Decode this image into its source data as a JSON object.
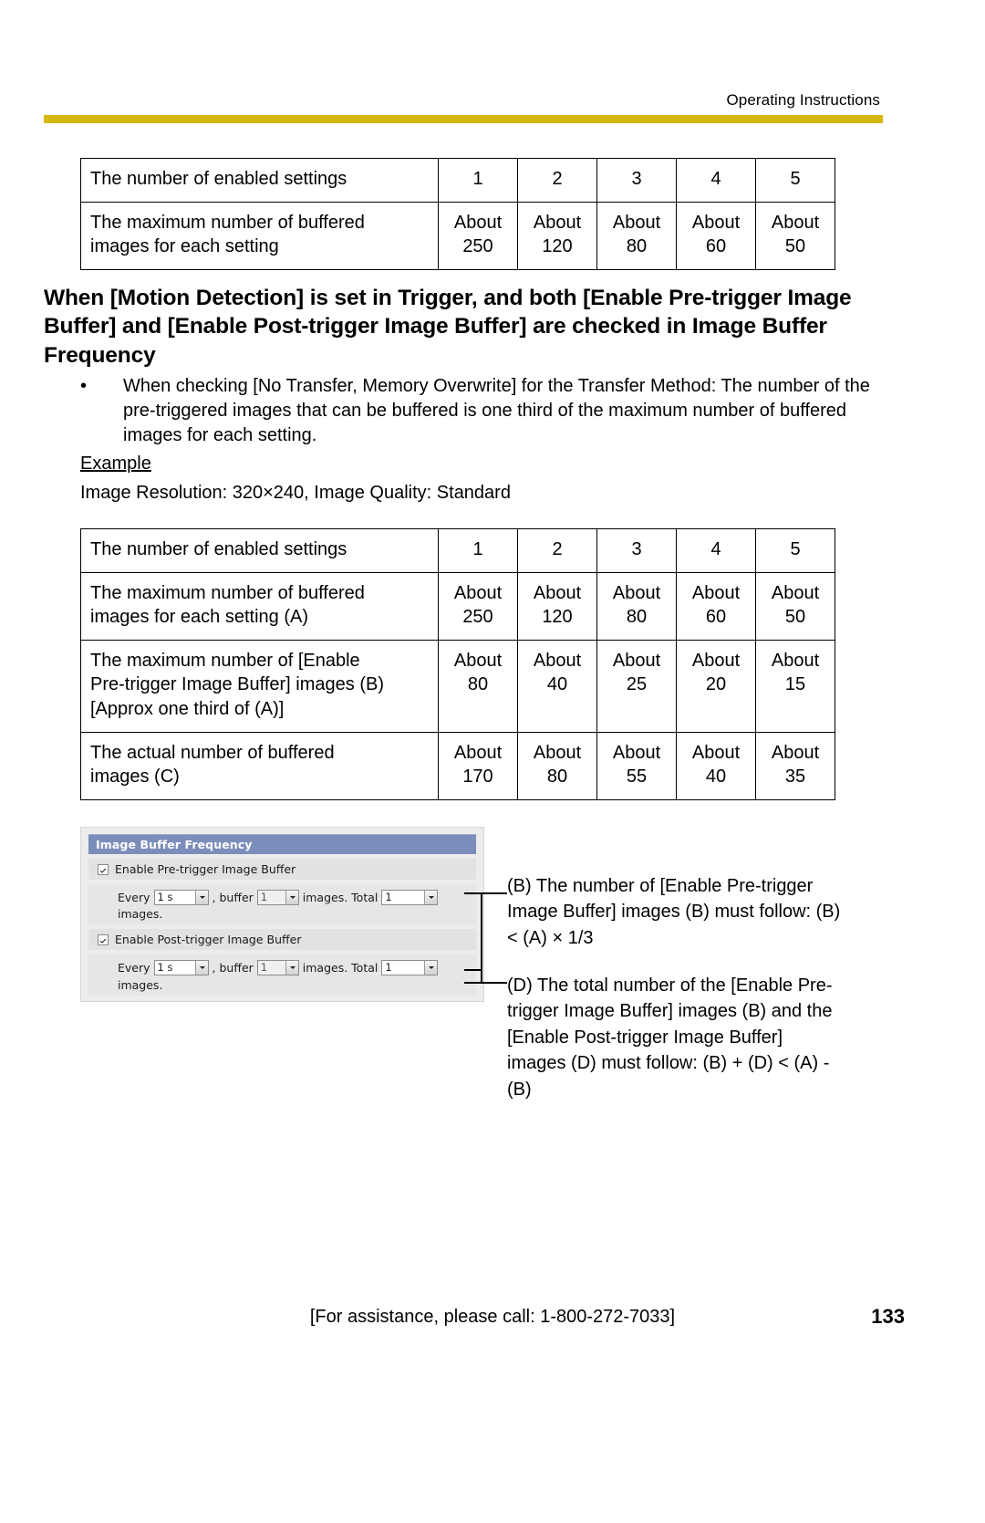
{
  "header": {
    "title": "Operating Instructions",
    "rule_color": "#d4b80c"
  },
  "table_top": {
    "rows": [
      {
        "label": "The number of enabled settings",
        "values": [
          "1",
          "2",
          "3",
          "4",
          "5"
        ]
      },
      {
        "label_line1": "The maximum number of buffered",
        "label_line2": "images for each setting",
        "about": "About",
        "values": [
          "250",
          "120",
          "80",
          "60",
          "50"
        ]
      }
    ]
  },
  "section": {
    "heading": "When [Motion Detection] is set in Trigger, and both [Enable Pre-trigger Image Buffer] and [Enable Post-trigger Image Buffer] are checked in Image Buffer Frequency",
    "bullet_dot": "•",
    "bullet_text": "When checking [No Transfer, Memory Overwrite] for the Transfer Method: The number of the pre-triggered images that can be buffered is one third of the maximum number of buffered images for each setting.",
    "example_label": "Example",
    "example_line": "Image Resolution: 320×240, Image Quality: Standard"
  },
  "table_example": {
    "rows": [
      {
        "label": "The number of enabled settings",
        "values": [
          "1",
          "2",
          "3",
          "4",
          "5"
        ]
      },
      {
        "label_line1": "The maximum number of buffered",
        "label_line2": "images for each setting (A)",
        "about": "About",
        "values": [
          "250",
          "120",
          "80",
          "60",
          "50"
        ]
      },
      {
        "label_line1": "The maximum number of [Enable",
        "label_line2": "Pre-trigger Image Buffer] images (B)",
        "label_line3": "[Approx one third of (A)]",
        "about": "About",
        "values": [
          "80",
          "40",
          "25",
          "20",
          "15"
        ]
      },
      {
        "label_line1": "The actual number of buffered",
        "label_line2": "images (C)",
        "about": "About",
        "values": [
          "170",
          "80",
          "55",
          "40",
          "35"
        ]
      }
    ]
  },
  "widget": {
    "title": "Image Buffer Frequency",
    "pre_trigger": {
      "checkbox_label": "Enable Pre-trigger Image Buffer",
      "checked": true,
      "every_label": "Every",
      "every_value": "1 s",
      "buffer_label": ", buffer",
      "buffer_value": "1",
      "images_label": "images. Total",
      "total_value": "1",
      "trailing_label": "images."
    },
    "post_trigger": {
      "checkbox_label": "Enable Post-trigger Image Buffer",
      "checked": true,
      "every_label": "Every",
      "every_value": "1 s",
      "buffer_label": ", buffer",
      "buffer_value": "1",
      "images_label": "images. Total",
      "total_value": "1",
      "trailing_label": "images."
    },
    "titlebar_color": "#7b8ebb",
    "background_color": "#ececec"
  },
  "callouts": {
    "b": "(B) The number of [Enable Pre-trigger Image Buffer] images (B) must follow: (B) < (A) × 1/3",
    "d": "(D) The total number of the [Enable Pre-trigger Image Buffer] images (B) and the [Enable Post-trigger Image Buffer] images (D) must follow: (B) + (D) < (A) - (B)"
  },
  "footer": {
    "assistance": "[For assistance, please call: 1-800-272-7033]",
    "page_number": "133"
  }
}
